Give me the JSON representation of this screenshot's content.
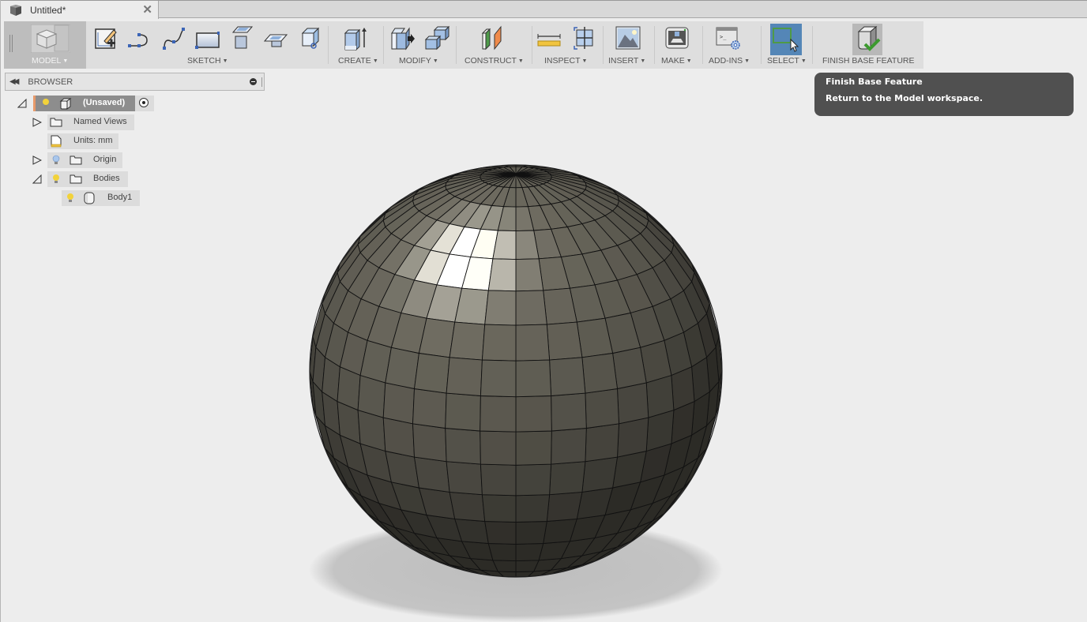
{
  "document": {
    "tab_title": "Untitled*",
    "close_icon": "close-x-icon"
  },
  "toolbar": {
    "workspace": {
      "label": "MODEL",
      "icon": "model-workspace-cube-icon"
    },
    "groups": [
      {
        "label": "SKETCH",
        "tools": [
          "create-sketch",
          "line",
          "spline",
          "rectangle",
          "project-include",
          "offset-plane",
          "box-point"
        ]
      },
      {
        "label": "CREATE",
        "tools": [
          "extrude"
        ]
      },
      {
        "label": "MODIFY",
        "tools": [
          "press-pull",
          "combine"
        ]
      },
      {
        "label": "CONSTRUCT",
        "tools": [
          "plane"
        ]
      },
      {
        "label": "INSPECT",
        "tools": [
          "measure",
          "section-analysis"
        ]
      },
      {
        "label": "INSERT",
        "tools": [
          "insert-image"
        ]
      },
      {
        "label": "MAKE",
        "tools": [
          "3d-print"
        ]
      },
      {
        "label": "ADD-INS",
        "tools": [
          "scripts-addins"
        ]
      },
      {
        "label": "SELECT",
        "tools": [
          "window-select"
        ],
        "active": true
      },
      {
        "label": "FINISH BASE FEATURE",
        "tools": [
          "finish-base-feature"
        ]
      }
    ]
  },
  "browser": {
    "title": "BROWSER",
    "tree": [
      {
        "label": "(Unsaved)",
        "level": 0,
        "expanded": true,
        "visible": true,
        "icon": "component-icon",
        "active": true
      },
      {
        "label": "Named Views",
        "level": 1,
        "expanded": false,
        "icon": "folder-icon"
      },
      {
        "label": "Units: mm",
        "level": 1,
        "icon": "units-ruler-doc-icon"
      },
      {
        "label": "Origin",
        "level": 1,
        "expanded": false,
        "visible": false,
        "icon": "folder-icon"
      },
      {
        "label": "Bodies",
        "level": 1,
        "expanded": true,
        "visible": true,
        "icon": "folder-icon"
      },
      {
        "label": "Body1",
        "level": 2,
        "visible": true,
        "icon": "body-icon"
      }
    ]
  },
  "tooltip": {
    "title": "Finish Base Feature",
    "description": "Return to the Model workspace."
  },
  "colors": {
    "select_active": "#5486b7",
    "tooltip_bg": "#505050",
    "root_marker": "#e89a6b",
    "bulb_on": "#f2d23a",
    "bulb_off": "#a9c7ec"
  },
  "viewport": {
    "object": "sphere-body",
    "meridians": 36,
    "parallels": 18
  }
}
